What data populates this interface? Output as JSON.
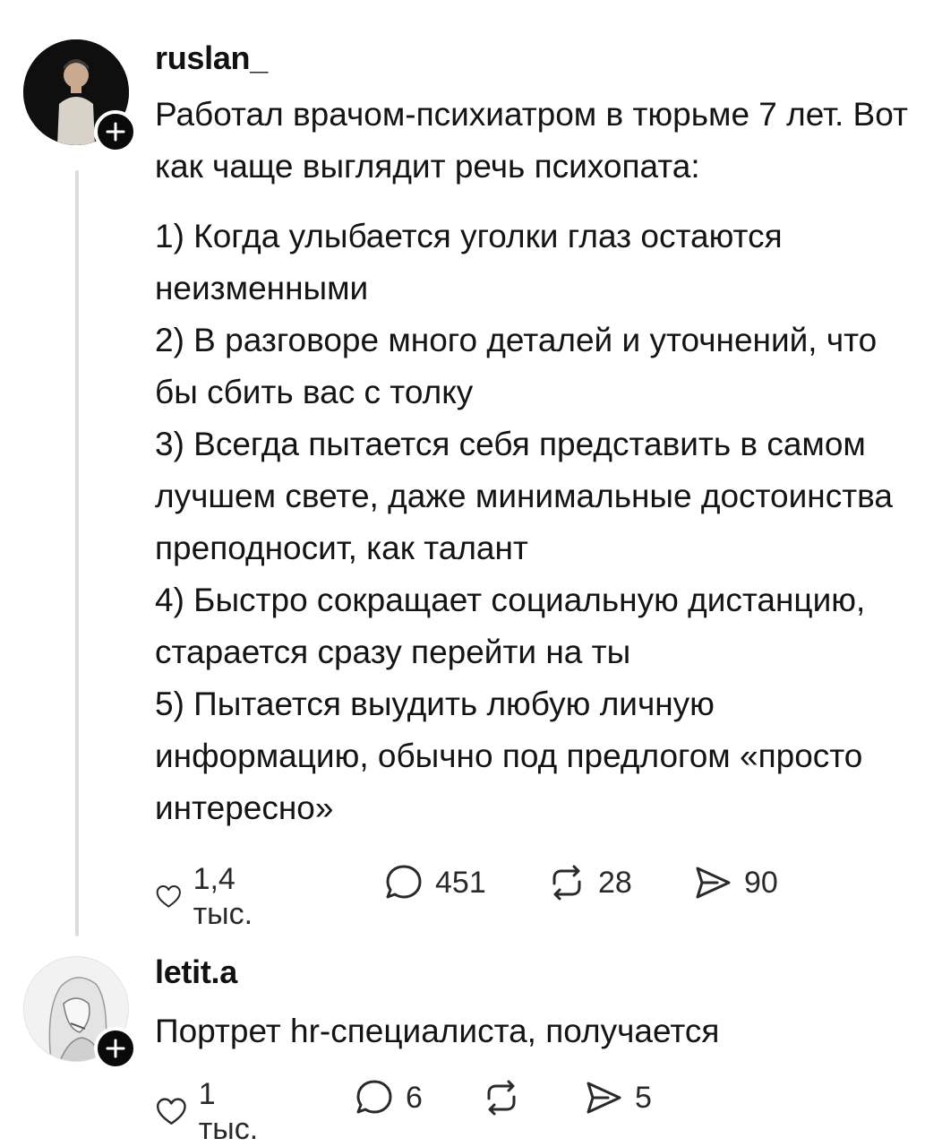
{
  "post": {
    "username": "ruslan_",
    "intro": "Работал врачом-психиатром в тюрьме 7 лет. Вот как чаще выглядит речь психопата:",
    "items": [
      "1) Когда улыбается уголки глаз остаются неизменными",
      "2) В разговоре много деталей и уточнений, что бы сбить вас с толку",
      "3) Всегда пытается себя представить в самом лучшем свете, даже минимальные достоинства преподносит, как талант",
      "4) Быстро сокращает социальную дистанцию, старается сразу перейти на ты",
      "5) Пытается выудить любую личную информацию, обычно под предлогом «просто интересно»"
    ],
    "actions": {
      "likes": "1,4 тыс.",
      "comments": "451",
      "reposts": "28",
      "shares": "90"
    }
  },
  "reply": {
    "username": "letit.a",
    "text": "Портрет hr-специалиста, получается",
    "actions": {
      "likes": "1 тыс.",
      "comments": "6",
      "reposts": "",
      "shares": "5"
    }
  },
  "icons": {
    "like": "heart-icon",
    "comment": "comment-bubble-icon",
    "repost": "repost-arrows-icon",
    "share": "send-icon",
    "follow": "plus-icon"
  }
}
